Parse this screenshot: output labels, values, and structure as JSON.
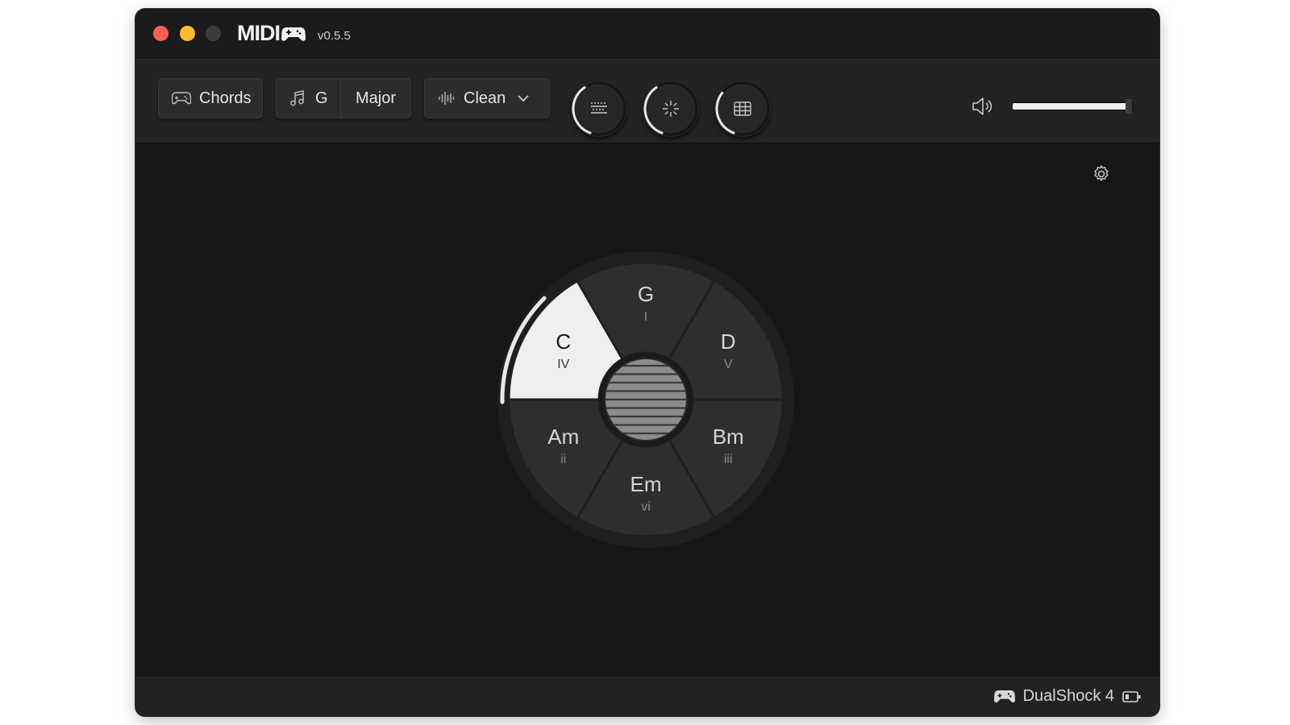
{
  "window": {
    "app_name": "MIDI",
    "version": "v0.5.5"
  },
  "toolbar": {
    "mode_button": {
      "label": "Chords",
      "icon": "gamepad-icon"
    },
    "key_button": {
      "label": "G",
      "icon": "music-note-icon"
    },
    "scale_button": {
      "label": "Major"
    },
    "sound_dropdown": {
      "label": "Clean",
      "icon": "waveform-icon",
      "chevron": "chevron-down-icon"
    },
    "knobs": [
      {
        "name": "keyboard-knob",
        "icon": "keyboard-icon",
        "level": 0.35
      },
      {
        "name": "sparkle-knob",
        "icon": "sparkle-icon",
        "level": 0.35
      },
      {
        "name": "grid-knob",
        "icon": "grid-icon",
        "level": 0.3
      }
    ],
    "volume": {
      "icon": "speaker-icon",
      "level": 0.97
    }
  },
  "settings_icon": "gear-icon",
  "chord_wheel": {
    "selected": "C",
    "segments": [
      {
        "chord": "G",
        "numeral": "I"
      },
      {
        "chord": "D",
        "numeral": "V"
      },
      {
        "chord": "Bm",
        "numeral": "iii"
      },
      {
        "chord": "Em",
        "numeral": "vi"
      },
      {
        "chord": "Am",
        "numeral": "ii"
      },
      {
        "chord": "C",
        "numeral": "IV"
      }
    ]
  },
  "status": {
    "controller_icon": "gamepad-icon",
    "controller_name": "DualShock 4",
    "battery_icon": "battery-icon"
  },
  "colors": {
    "window_bg": "#161616",
    "segment": "#2e2e2e",
    "segment_selected": "#efefef",
    "accent_red": "#fe5f57",
    "accent_yellow": "#febc2e"
  }
}
